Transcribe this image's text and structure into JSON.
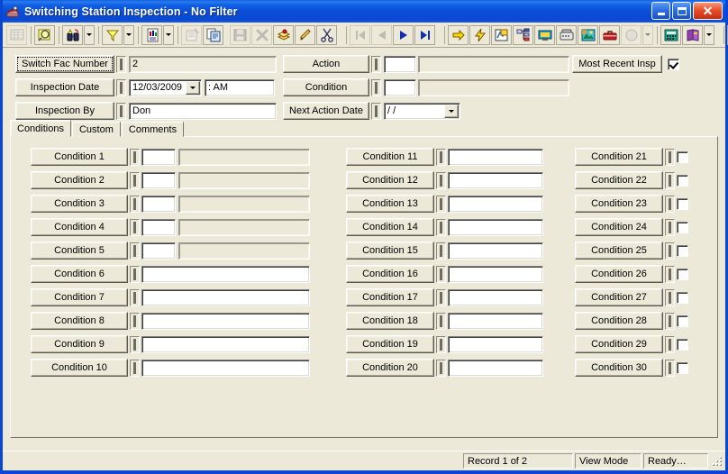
{
  "window": {
    "title": "Switching Station Inspection  - No Filter",
    "icon": "application-icon",
    "controls": {
      "minimize": "minimize-button",
      "maximize": "maximize-button",
      "close": "close-button"
    }
  },
  "toolbar": {
    "buttons": [
      {
        "name": "grid-view-icon",
        "disabled": true,
        "dropdown": false
      },
      {
        "name": "search-magnifier-icon",
        "disabled": false,
        "dropdown": false
      },
      {
        "name": "binoculars-find-icon",
        "disabled": false,
        "dropdown": true
      },
      {
        "name": "filter-funnel-icon",
        "disabled": false,
        "dropdown": true
      },
      {
        "name": "report-document-icon",
        "disabled": false,
        "dropdown": true
      },
      {
        "name": "properties-icon",
        "disabled": true,
        "dropdown": false
      },
      {
        "name": "copy-record-icon",
        "disabled": false,
        "dropdown": false
      },
      {
        "name": "save-icon",
        "disabled": true,
        "dropdown": false
      },
      {
        "name": "delete-icon",
        "disabled": true,
        "dropdown": false
      },
      {
        "name": "layers-icon",
        "disabled": false,
        "dropdown": false
      },
      {
        "name": "edit-pencil-icon",
        "disabled": false,
        "dropdown": false
      },
      {
        "name": "cut-scissors-icon",
        "disabled": false,
        "dropdown": false
      },
      {
        "name": "first-record-icon",
        "disabled": true,
        "dropdown": false
      },
      {
        "name": "previous-record-icon",
        "disabled": true,
        "dropdown": false
      },
      {
        "name": "next-record-icon",
        "disabled": false,
        "dropdown": false
      },
      {
        "name": "last-record-icon",
        "disabled": false,
        "dropdown": false
      },
      {
        "name": "goto-arrow-icon",
        "disabled": false,
        "dropdown": false
      },
      {
        "name": "lightning-icon",
        "disabled": false,
        "dropdown": false
      },
      {
        "name": "map-window-icon",
        "disabled": false,
        "dropdown": false
      },
      {
        "name": "tree-structure-icon",
        "disabled": false,
        "dropdown": false
      },
      {
        "name": "monitor-icon",
        "disabled": false,
        "dropdown": false
      },
      {
        "name": "phone-icon",
        "disabled": false,
        "dropdown": false
      },
      {
        "name": "picture-icon",
        "disabled": false,
        "dropdown": false
      },
      {
        "name": "toolbox-icon",
        "disabled": false,
        "dropdown": false
      },
      {
        "name": "clock-icon",
        "disabled": true,
        "dropdown": true
      },
      {
        "name": "calculator-icon",
        "disabled": false,
        "dropdown": false
      },
      {
        "name": "book-icon",
        "disabled": false,
        "dropdown": true
      },
      {
        "name": "export-icon",
        "disabled": false,
        "dropdown": false
      }
    ]
  },
  "header": {
    "left_fields": [
      {
        "label": "Switch Fac Number",
        "value": "2",
        "focused": true
      },
      {
        "label": "Inspection Date",
        "value": "12/03/2009",
        "time": ":   AM",
        "focused": false
      },
      {
        "label": "Inspection By",
        "value": "Don",
        "focused": false
      }
    ],
    "middle_fields": [
      {
        "label": "Action",
        "code": "",
        "desc": ""
      },
      {
        "label": "Condition",
        "code": "",
        "desc": ""
      },
      {
        "label": "Next Action Date",
        "value": "  /  /"
      }
    ],
    "most_recent": {
      "label": "Most Recent Insp",
      "checked": true
    }
  },
  "tabs": [
    {
      "label": "Conditions",
      "active": true
    },
    {
      "label": "Custom",
      "active": false
    },
    {
      "label": "Comments",
      "active": false
    }
  ],
  "conditions": {
    "column1": [
      {
        "label": "Condition 1",
        "code": "",
        "desc": "",
        "style": "split"
      },
      {
        "label": "Condition 2",
        "code": "",
        "desc": "",
        "style": "split"
      },
      {
        "label": "Condition 3",
        "code": "",
        "desc": "",
        "style": "split"
      },
      {
        "label": "Condition 4",
        "code": "",
        "desc": "",
        "style": "split"
      },
      {
        "label": "Condition 5",
        "code": "",
        "desc": "",
        "style": "split"
      },
      {
        "label": "Condition 6",
        "value": "",
        "style": "wide"
      },
      {
        "label": "Condition 7",
        "value": "",
        "style": "wide"
      },
      {
        "label": "Condition 8",
        "value": "",
        "style": "wide"
      },
      {
        "label": "Condition 9",
        "value": "",
        "style": "wide"
      },
      {
        "label": "Condition 10",
        "value": "",
        "style": "wide"
      }
    ],
    "column2": [
      {
        "label": "Condition 11",
        "value": ""
      },
      {
        "label": "Condition 12",
        "value": ""
      },
      {
        "label": "Condition 13",
        "value": ""
      },
      {
        "label": "Condition 14",
        "value": ""
      },
      {
        "label": "Condition 15",
        "value": ""
      },
      {
        "label": "Condition 16",
        "value": ""
      },
      {
        "label": "Condition 17",
        "value": ""
      },
      {
        "label": "Condition 18",
        "value": ""
      },
      {
        "label": "Condition 19",
        "value": ""
      },
      {
        "label": "Condition 20",
        "value": ""
      }
    ],
    "column3": [
      {
        "label": "Condition 21",
        "checked": false
      },
      {
        "label": "Condition 22",
        "checked": false
      },
      {
        "label": "Condition 23",
        "checked": false
      },
      {
        "label": "Condition 24",
        "checked": false
      },
      {
        "label": "Condition 25",
        "checked": false
      },
      {
        "label": "Condition 26",
        "checked": false
      },
      {
        "label": "Condition 27",
        "checked": false
      },
      {
        "label": "Condition 28",
        "checked": false
      },
      {
        "label": "Condition 29",
        "checked": false
      },
      {
        "label": "Condition 30",
        "checked": false
      }
    ]
  },
  "statusbar": {
    "record": "Record 1 of 2",
    "mode": "View Mode",
    "state": "Ready…"
  },
  "colors": {
    "title_blue": "#0a46d4",
    "face": "#ece9d8",
    "field_white": "#ffffff",
    "shadow": "#808080"
  }
}
